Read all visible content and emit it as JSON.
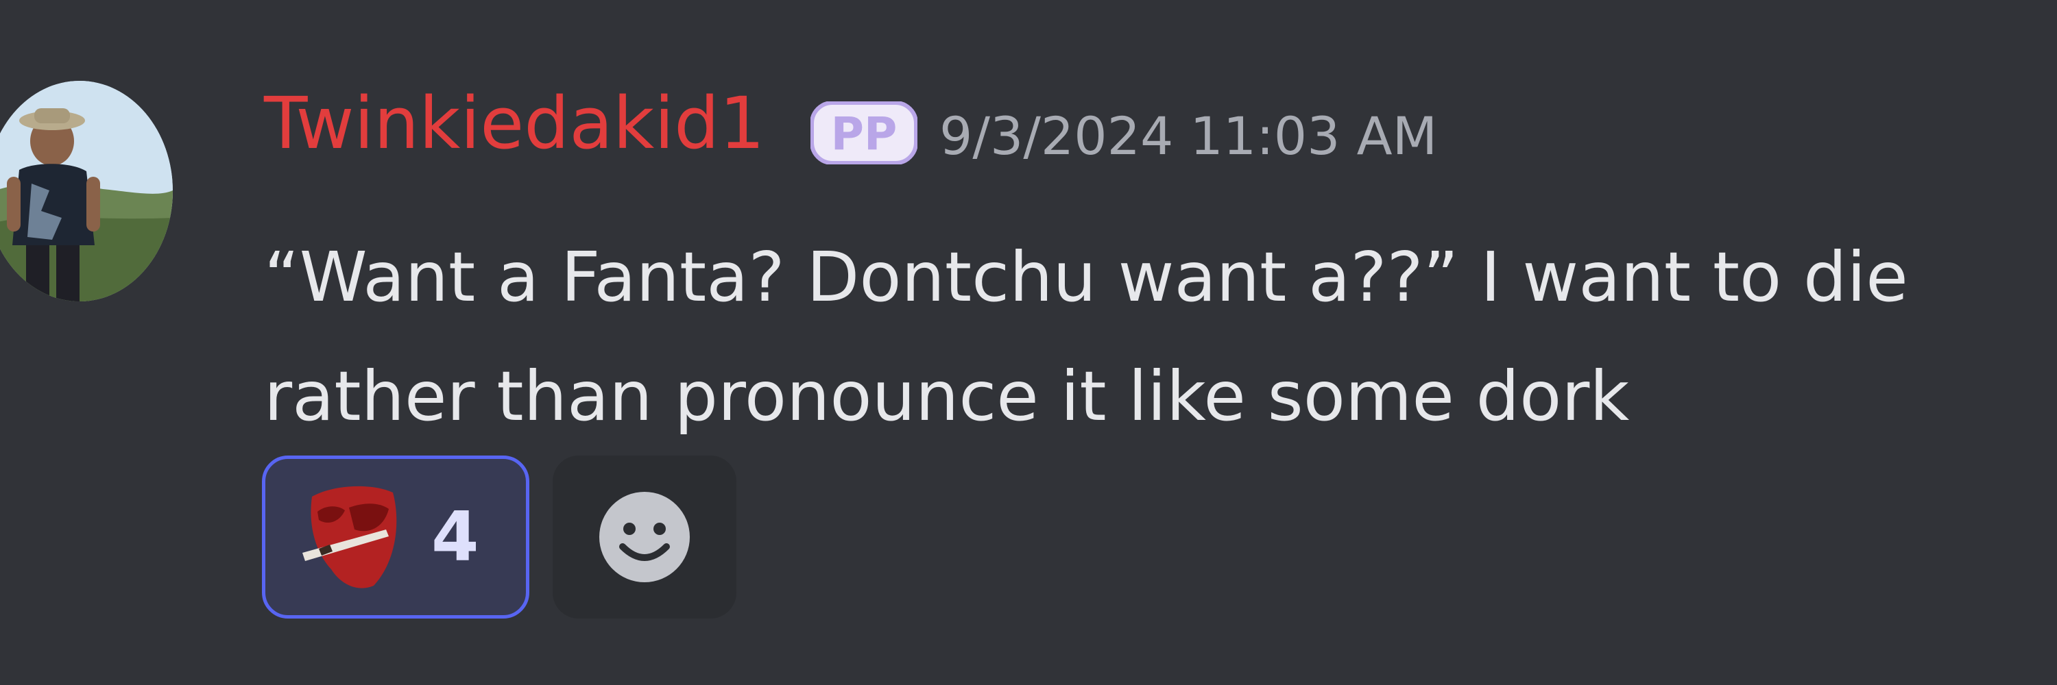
{
  "message": {
    "author": {
      "username": "Twinkiedakid1",
      "username_color": "#e23d3d",
      "avatar": "profile-photo"
    },
    "tag_badge": {
      "text": "PP",
      "color": "#b9a6e8"
    },
    "timestamp": "9/3/2024 11:03 AM",
    "content_lines": [
      "“Want a Fanta? Dontchu want a??” I want to die",
      "rather than pronounce it like some dork"
    ]
  },
  "reactions": [
    {
      "emoji": "red-mask-emoji",
      "count": "4",
      "selected": true
    }
  ],
  "add_reaction": {
    "icon": "smiley-icon"
  },
  "colors": {
    "background": "#313338",
    "text": "#e7e8eb",
    "timestamp": "#a8abb3",
    "reaction_border": "#5865f2"
  }
}
